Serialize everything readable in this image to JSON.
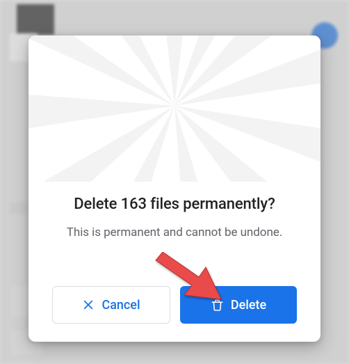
{
  "dialog": {
    "title": "Delete 163 files permanently?",
    "subtitle": "This is permanent and cannot be undone.",
    "cancel_label": "Cancel",
    "delete_label": "Delete"
  },
  "colors": {
    "primary": "#1a73e8",
    "text": "#202124",
    "secondary_text": "#5f6368",
    "border": "#dadce0",
    "arrow": "#e94b4b"
  }
}
